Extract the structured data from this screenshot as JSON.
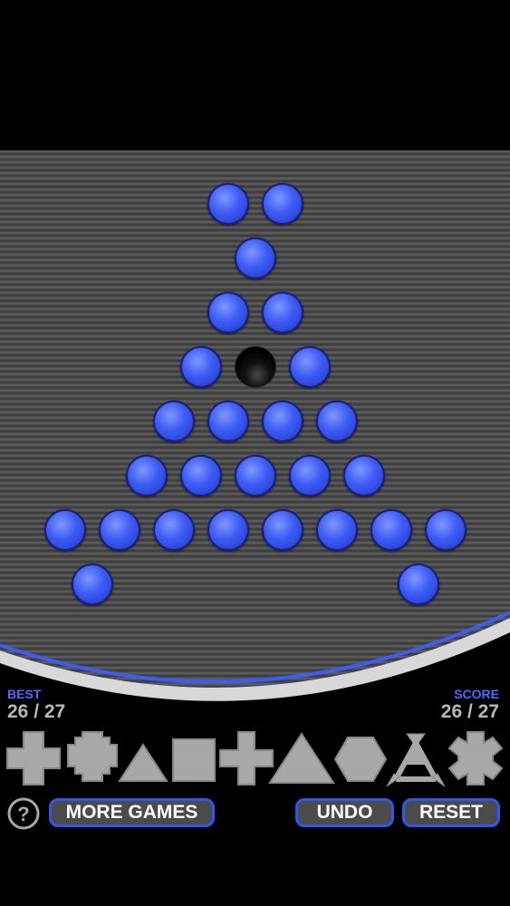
{
  "board": {
    "peg_color": "#3d5cf5",
    "holes": [
      {
        "row": 0,
        "col": 3,
        "filled": true
      },
      {
        "row": 0,
        "col": 4,
        "filled": true
      },
      {
        "row": 1,
        "col": 3.5,
        "filled": true
      },
      {
        "row": 2,
        "col": 3,
        "filled": true
      },
      {
        "row": 2,
        "col": 4,
        "filled": true
      },
      {
        "row": 3,
        "col": 2.5,
        "filled": true
      },
      {
        "row": 3,
        "col": 3.5,
        "filled": false
      },
      {
        "row": 3,
        "col": 4.5,
        "filled": true
      },
      {
        "row": 4,
        "col": 2,
        "filled": true
      },
      {
        "row": 4,
        "col": 3,
        "filled": true
      },
      {
        "row": 4,
        "col": 4,
        "filled": true
      },
      {
        "row": 4,
        "col": 5,
        "filled": true
      },
      {
        "row": 5,
        "col": 1.5,
        "filled": true
      },
      {
        "row": 5,
        "col": 2.5,
        "filled": true
      },
      {
        "row": 5,
        "col": 3.5,
        "filled": true
      },
      {
        "row": 5,
        "col": 4.5,
        "filled": true
      },
      {
        "row": 5,
        "col": 5.5,
        "filled": true
      },
      {
        "row": 6,
        "col": 0,
        "filled": true
      },
      {
        "row": 6,
        "col": 1,
        "filled": true
      },
      {
        "row": 6,
        "col": 2,
        "filled": true
      },
      {
        "row": 6,
        "col": 3,
        "filled": true
      },
      {
        "row": 6,
        "col": 4,
        "filled": true
      },
      {
        "row": 6,
        "col": 5,
        "filled": true
      },
      {
        "row": 6,
        "col": 6,
        "filled": true
      },
      {
        "row": 6,
        "col": 7,
        "filled": true
      },
      {
        "row": 7,
        "col": 0.5,
        "filled": true
      },
      {
        "row": 7,
        "col": 6.5,
        "filled": true
      }
    ]
  },
  "stats": {
    "best_label": "BEST",
    "best_value": "26 / 27",
    "score_label": "SCORE",
    "score_value": "26 / 27"
  },
  "shapes": [
    {
      "name": "cross-shape-icon"
    },
    {
      "name": "octagon-shape-icon"
    },
    {
      "name": "small-triangle-shape-icon"
    },
    {
      "name": "square-shape-icon"
    },
    {
      "name": "plus-shape-icon"
    },
    {
      "name": "large-triangle-shape-icon"
    },
    {
      "name": "hexagon-shape-icon"
    },
    {
      "name": "tripod-shape-icon"
    },
    {
      "name": "asterisk-shape-icon"
    }
  ],
  "buttons": {
    "help_label": "?",
    "more_games_label": "MORE GAMES",
    "undo_label": "UNDO",
    "reset_label": "RESET"
  },
  "colors": {
    "accent": "#2f56f0",
    "label_blue": "#4c6cff",
    "shape_gray": "#a8a8a8"
  }
}
